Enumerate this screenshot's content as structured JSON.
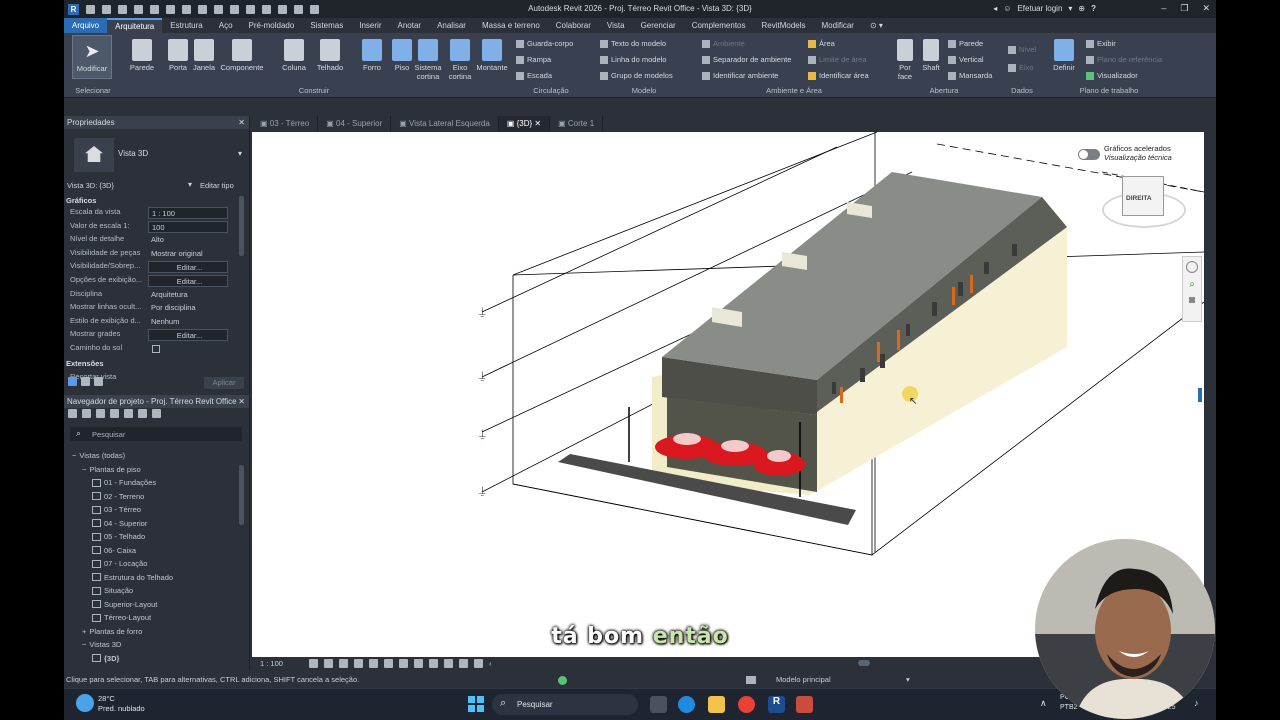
{
  "app": {
    "title": "Autodesk Revit 2026 - Proj. Térreo Revit Office - Vista 3D: {3D}",
    "login": "Efetuar login",
    "help": "?"
  },
  "ribbon_tabs": [
    "Arquivo",
    "Arquitetura",
    "Estrutura",
    "Aço",
    "Pré-moldado",
    "Sistemas",
    "Inserir",
    "Anotar",
    "Analisar",
    "Massa e terreno",
    "Colaborar",
    "Vista",
    "Gerenciar",
    "Complementos",
    "RevitModels",
    "Modificar"
  ],
  "ribbon": {
    "select": {
      "modify": "Modificar",
      "label": "Selecionar"
    },
    "build": {
      "label": "Construir",
      "items": [
        "Parede",
        "Porta",
        "Janela",
        "Componente",
        "Coluna",
        "Telhado",
        "Forro",
        "Piso",
        "Sistema cortina",
        "Eixo cortina",
        "Montante"
      ]
    },
    "circulation": {
      "label": "Circulação",
      "items": [
        "Guarda-corpo",
        "Rampa",
        "Escada"
      ]
    },
    "model": {
      "label": "Modelo",
      "items": [
        "Texto do modelo",
        "Linha do modelo",
        "Grupo de modelos"
      ]
    },
    "room": {
      "label": "Ambiente e Área",
      "items": [
        "Ambiente",
        "Separador de ambiente",
        "Identificar ambiente",
        "Área",
        "Limite de área",
        "Identificar área"
      ]
    },
    "opening": {
      "label": "Abertura",
      "items": [
        "Por face",
        "Shaft",
        "Parede",
        "Vertical",
        "Mansarda"
      ]
    },
    "datum": {
      "label": "Dados",
      "items": [
        "Nível",
        "Eixo"
      ]
    },
    "workplane": {
      "label": "Plano de trabalho",
      "items": [
        "Definir",
        "Exibir",
        "Plano de referência",
        "Visualizador"
      ]
    }
  },
  "properties": {
    "title": "Propriedades",
    "type": "Vista 3D",
    "selector": "Vista 3D: {3D}",
    "edit_type": "Editar tipo",
    "section_graphics": "Gráficos",
    "rows": [
      {
        "label": "Escala da vista",
        "value": "1 : 100"
      },
      {
        "label": "Valor de escala    1:",
        "value": "100"
      },
      {
        "label": "Nível de detalhe",
        "value": "Alto"
      },
      {
        "label": "Visibilidade de peças",
        "value": "Mostrar original"
      },
      {
        "label": "Visibilidade/Sobrep...",
        "value": "Editar..."
      },
      {
        "label": "Opções de exibição...",
        "value": "Editar..."
      },
      {
        "label": "Disciplina",
        "value": "Arquitetura"
      },
      {
        "label": "Mostrar linhas ocult...",
        "value": "Por disciplina"
      },
      {
        "label": "Estilo de exibição d...",
        "value": "Nenhum"
      },
      {
        "label": "Mostrar grades",
        "value": "Editar..."
      },
      {
        "label": "Caminho do sol",
        "value": ""
      }
    ],
    "section_extents": "Extensões",
    "crop": "Recortar vista",
    "apply": "Aplicar"
  },
  "browser": {
    "title": "Navegador de projeto - Proj. Térreo Revit Office",
    "search_placeholder": "Pesquisar",
    "nodes": [
      {
        "label": "Vistas (todas)",
        "level": 0
      },
      {
        "label": "Plantas de piso",
        "level": 1
      },
      {
        "label": "01 - Fundações",
        "level": 2
      },
      {
        "label": "02 - Terreno",
        "level": 2
      },
      {
        "label": "03 - Térreo",
        "level": 2
      },
      {
        "label": "04 - Superior",
        "level": 2
      },
      {
        "label": "05 - Telhado",
        "level": 2
      },
      {
        "label": "06- Caixa",
        "level": 2
      },
      {
        "label": "07 - Locação",
        "level": 2
      },
      {
        "label": "Estrutura do Telhado",
        "level": 2
      },
      {
        "label": "Situação",
        "level": 2
      },
      {
        "label": "Superior-Layout",
        "level": 2
      },
      {
        "label": "Térreo-Layout",
        "level": 2
      },
      {
        "label": "Plantas de forro",
        "level": 1
      },
      {
        "label": "Vistas 3D",
        "level": 1
      },
      {
        "label": "{3D}",
        "level": 2
      }
    ]
  },
  "view_tabs": [
    "03 - Térreo",
    "04 - Superior",
    "Vista Lateral Esquerda",
    "{3D}",
    "Corte 1"
  ],
  "canvas": {
    "accel_title": "Gráficos acelerados",
    "accel_sub": "Visualização técnica",
    "viewcube": "DIREITA"
  },
  "view_bar": {
    "scale": "1 : 100",
    "model": "Modelo principal"
  },
  "status": "Clique para selecionar, TAB para alternativas, CTRL adiciona, SHIFT cancela a seleção.",
  "taskbar": {
    "temp": "28°C",
    "weather": "Pred. nublado",
    "search": "Pesquisar",
    "lang1": "PO",
    "lang2": "PTB2",
    "date": "2025"
  },
  "subtitle": {
    "w1": "tá bom",
    "w2": "então"
  }
}
